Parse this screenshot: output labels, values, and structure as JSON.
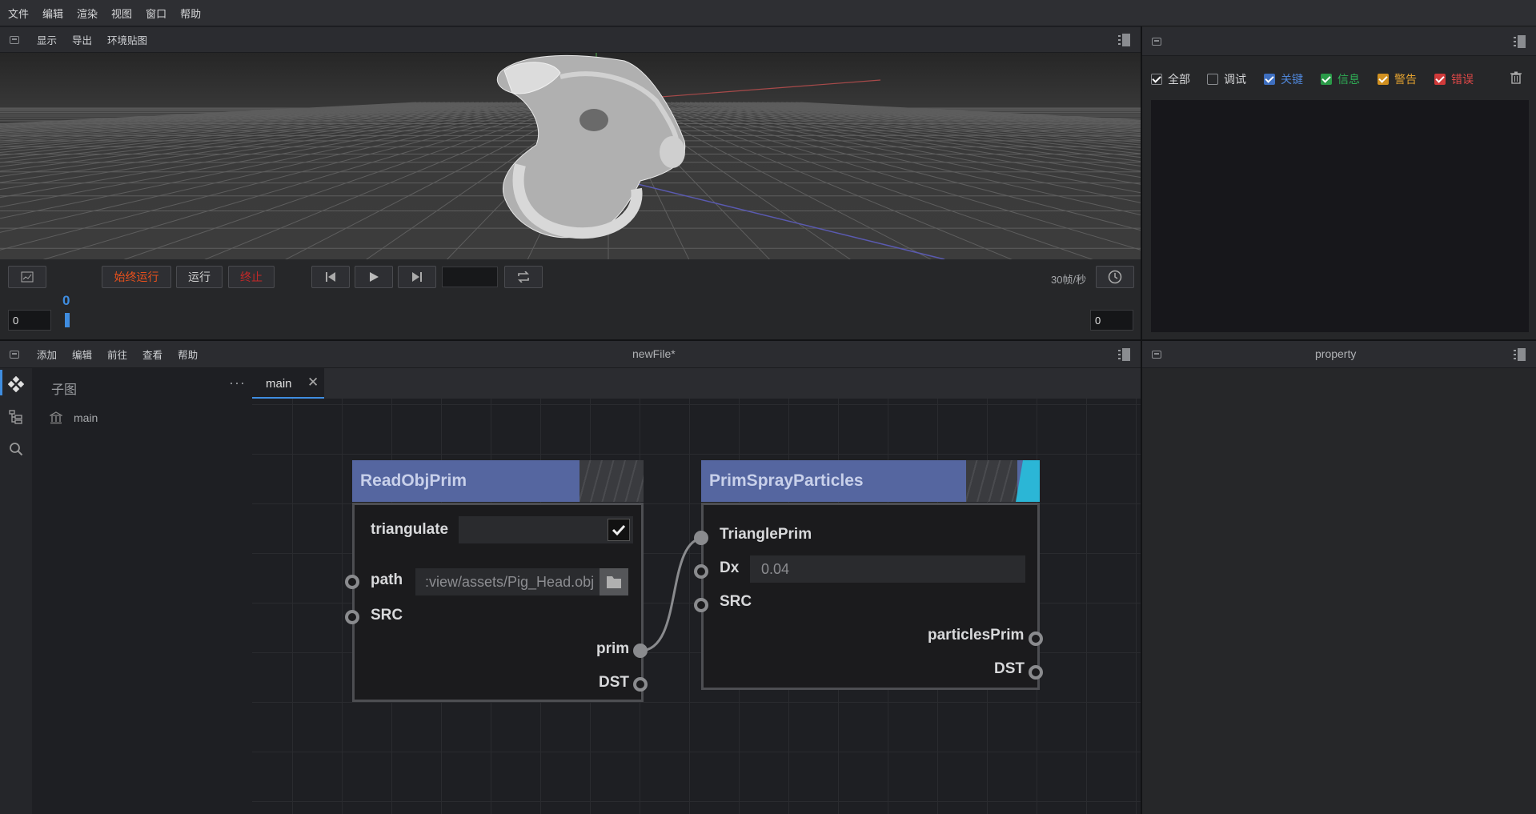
{
  "menubar": {
    "items": [
      "文件",
      "编辑",
      "渲染",
      "视图",
      "窗口",
      "帮助"
    ]
  },
  "viewport_bar": {
    "items": [
      "显示",
      "导出",
      "环境贴图"
    ]
  },
  "timeline": {
    "always_run_label": "始终运行",
    "run_label": "运行",
    "stop_label": "终止",
    "start_frame": "0",
    "end_frame": "0",
    "current_frame": "0",
    "fps_label": "30帧/秒",
    "colors": {
      "always_run": "#e8501c",
      "stop": "#c62828",
      "frame_marker": "#3f8de0"
    }
  },
  "log_panel": {
    "filters": [
      {
        "label": "全部",
        "checked": true,
        "color": "#d6d7d9"
      },
      {
        "label": "调试",
        "checked": false,
        "color": "#d6d7d9"
      },
      {
        "label": "关键",
        "checked": true,
        "color": "#4f86d8"
      },
      {
        "label": "信息",
        "checked": true,
        "color": "#2fae55"
      },
      {
        "label": "警告",
        "checked": true,
        "color": "#e0a030"
      },
      {
        "label": "错误",
        "checked": true,
        "color": "#e04848"
      }
    ]
  },
  "graph_bar": {
    "items": [
      "添加",
      "编辑",
      "前往",
      "查看",
      "帮助"
    ],
    "title": "newFile*"
  },
  "property_panel": {
    "title": "property"
  },
  "tree": {
    "title": "子图",
    "items": [
      "main"
    ]
  },
  "tabs": [
    {
      "label": "main"
    }
  ],
  "nodes": {
    "read": {
      "title": "ReadObjPrim",
      "triangulate_label": "triangulate",
      "path_label": "path",
      "path_value": ":view/assets/Pig_Head.obj",
      "src_label": "SRC",
      "prim_label": "prim",
      "dst_label": "DST"
    },
    "spray": {
      "title": "PrimSprayParticles",
      "triangle_label": "TrianglePrim",
      "dx_label": "Dx",
      "dx_value": "0.04",
      "src_label": "SRC",
      "particles_label": "particlesPrim",
      "dst_label": "DST",
      "accent": "#2bb6d6"
    }
  }
}
